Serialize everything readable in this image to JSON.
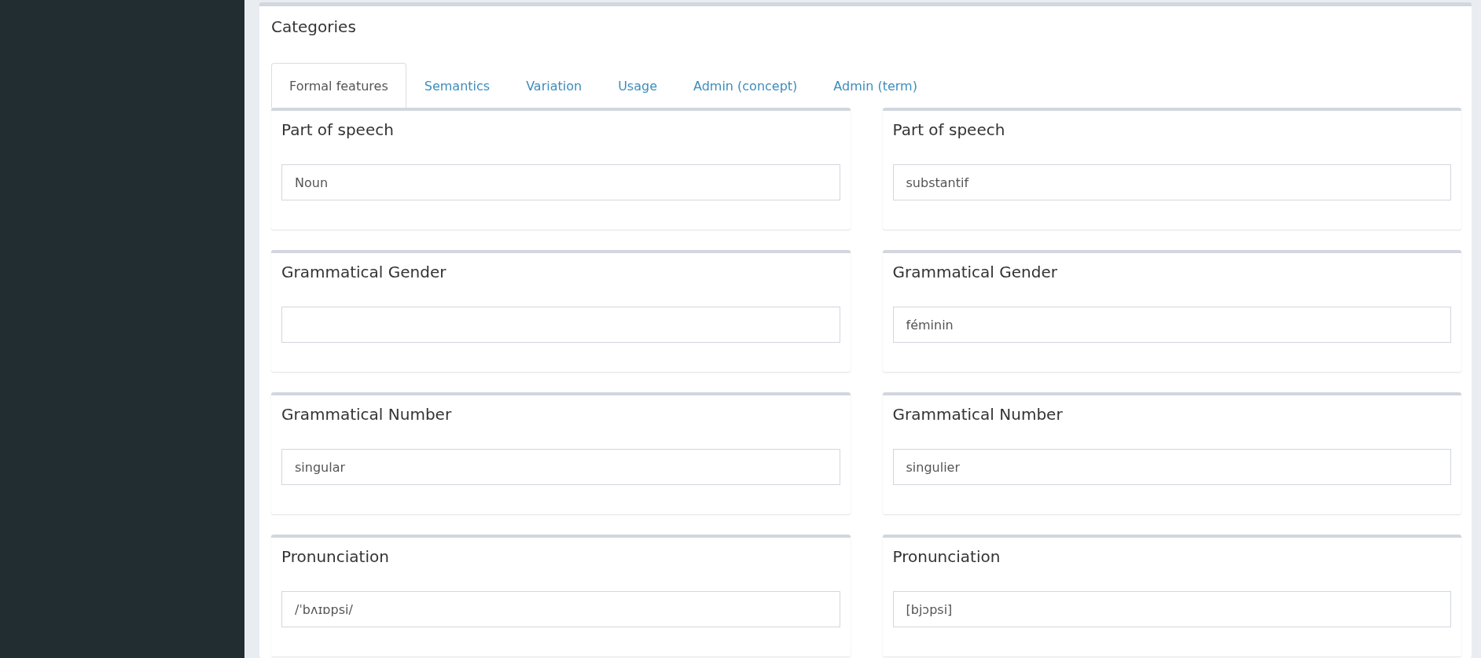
{
  "panel": {
    "title": "Categories"
  },
  "tabs": [
    {
      "label": "Formal features",
      "selected": true
    },
    {
      "label": "Semantics",
      "selected": false
    },
    {
      "label": "Variation",
      "selected": false
    },
    {
      "label": "Usage",
      "selected": false
    },
    {
      "label": "Admin (concept)",
      "selected": false
    },
    {
      "label": "Admin (term)",
      "selected": false
    }
  ],
  "rows": [
    {
      "left": {
        "label": "Part of speech",
        "value": "Noun"
      },
      "right": {
        "label": "Part of speech",
        "value": "substantif"
      }
    },
    {
      "left": {
        "label": "Grammatical Gender"
      },
      "right": {
        "label": "Grammatical Gender",
        "value": "féminin"
      }
    },
    {
      "left": {
        "label": "Grammatical Number",
        "value": "singular"
      },
      "right": {
        "label": "Grammatical Number",
        "value": "singulier"
      }
    },
    {
      "left": {
        "label": "Pronunciation",
        "value": "/ˈbʌɪɒpsi/"
      },
      "right": {
        "label": "Pronunciation",
        "value": "[bjɔpsi]"
      }
    }
  ]
}
